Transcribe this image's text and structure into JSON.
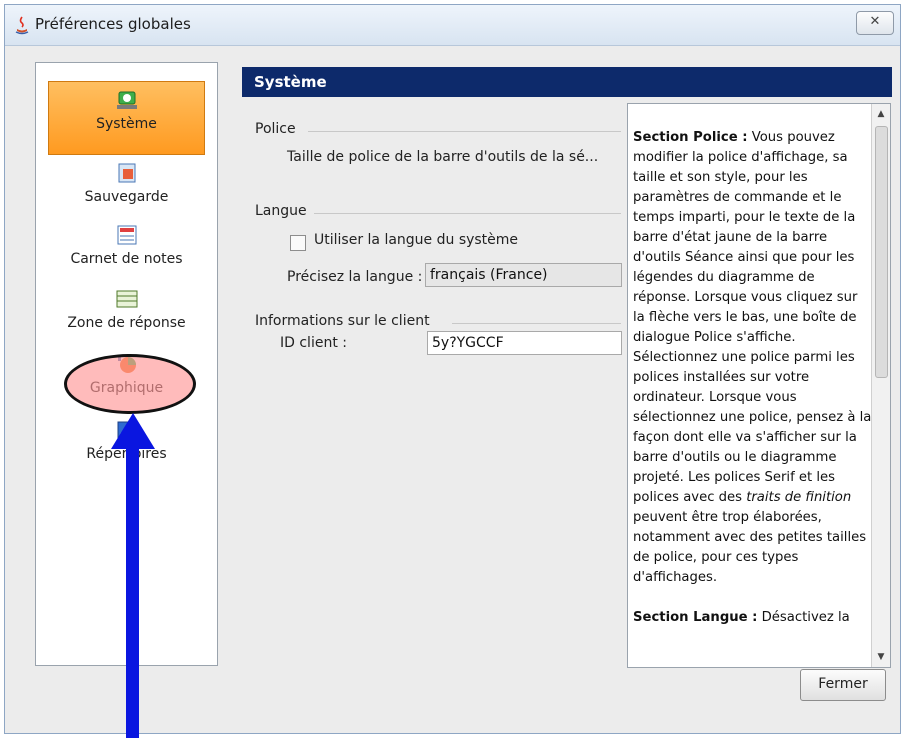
{
  "window": {
    "title": "Préférences globales",
    "close_label": "ᅟ⊠"
  },
  "nav": {
    "items": [
      {
        "label": "Système",
        "icon": "system-icon"
      },
      {
        "label": "Sauvegarde",
        "icon": "save-icon"
      },
      {
        "label": "Carnet de notes",
        "icon": "gradebook-icon"
      },
      {
        "label": "Zone de réponse",
        "icon": "response-zone-icon"
      },
      {
        "label": "Graphique",
        "icon": "chart-icon"
      },
      {
        "label": "Répertoires",
        "icon": "folders-icon"
      }
    ]
  },
  "content": {
    "header": "Système",
    "sections": {
      "police": {
        "title": "Police",
        "font_size_label": "Taille de police de la barre d'outils de la sé..."
      },
      "langue": {
        "title": "Langue",
        "use_system_label": "Utiliser la langue du système",
        "specify_label": "Précisez la langue :",
        "language_value": "français (France)"
      },
      "client": {
        "title": "Informations sur le client",
        "id_label": "ID client :",
        "id_value": "5y?YGCCF"
      }
    },
    "help": {
      "p1_bold": "Section Police :",
      "p1_text": " Vous pouvez modifier la police d'affichage, sa taille et son style, pour les paramètres de commande et le temps imparti, pour le texte de la barre d'état jaune de la barre d'outils Séance ainsi que pour les légendes du diagramme de réponse. Lorsque vous cliquez sur la flèche vers le bas, une boîte de dialogue Police s'affiche. Sélectionnez une police parmi les polices installées sur votre ordinateur. Lorsque vous sélectionnez une police, pensez à la façon dont elle va s'afficher sur la barre d'outils ou le diagramme projeté. Les polices Serif et les polices avec des ",
      "p1_italic": "traits de finition",
      "p1_tail": " peuvent être trop élaborées, notamment avec des petites tailles de police, pour ces types d'affichages.",
      "p2_bold": "Section Langue :",
      "p2_text": " Désactivez la"
    }
  },
  "footer": {
    "close_button": "Fermer"
  },
  "colors": {
    "header_bg": "#0d2a6b",
    "selected_nav": "#ff9a20",
    "annotation_arrow": "#0a16e0"
  }
}
